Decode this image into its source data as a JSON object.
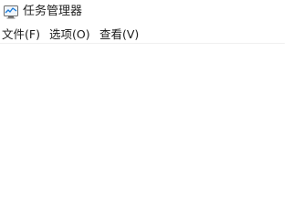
{
  "window": {
    "title": "任务管理器",
    "icon": "task-manager-icon"
  },
  "menubar": {
    "items": [
      {
        "label": "文件(F)"
      },
      {
        "label": "选项(O)"
      },
      {
        "label": "查看(V)"
      }
    ]
  }
}
